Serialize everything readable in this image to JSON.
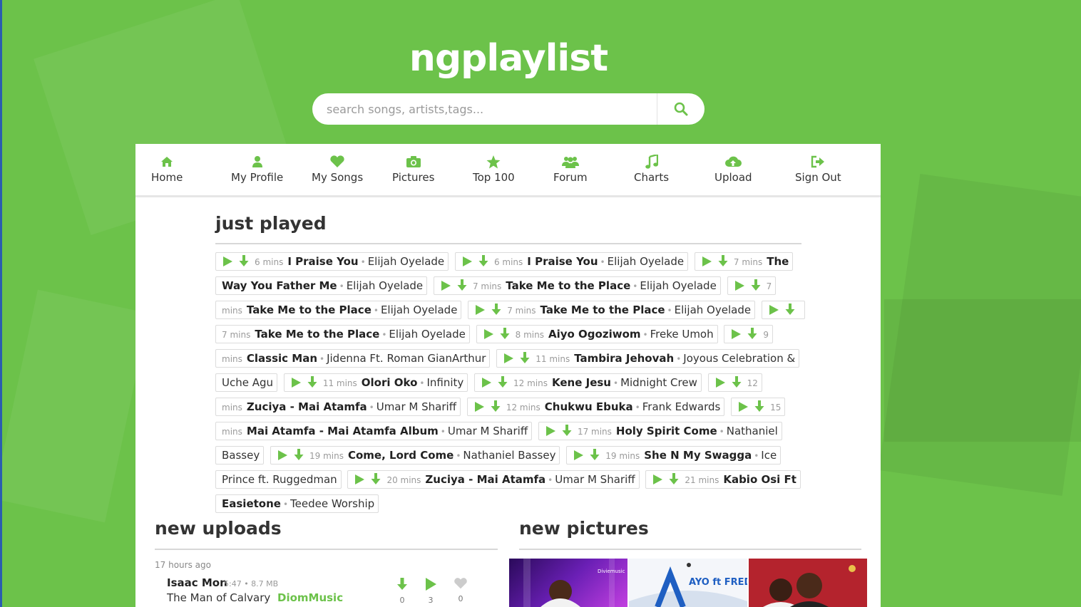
{
  "site": {
    "logo": "ngplaylist"
  },
  "search": {
    "placeholder": "search songs, artists,tags...",
    "value": ""
  },
  "nav": [
    {
      "label": "Home",
      "icon": "home-icon"
    },
    {
      "label": "My Profile",
      "icon": "user-icon"
    },
    {
      "label": "My Songs",
      "icon": "heart-icon"
    },
    {
      "label": "Pictures",
      "icon": "camera-icon"
    },
    {
      "label": "Top 100",
      "icon": "star-icon"
    },
    {
      "label": "Forum",
      "icon": "users-icon"
    },
    {
      "label": "Charts",
      "icon": "music-icon"
    },
    {
      "label": "Upload",
      "icon": "cloud-upload-icon"
    },
    {
      "label": "Sign Out",
      "icon": "sign-out-icon"
    }
  ],
  "just_played": {
    "heading": "just played",
    "songs": [
      {
        "mins": "6 mins",
        "title": "I Praise You",
        "artist": "Elijah Oyelade"
      },
      {
        "mins": "6 mins",
        "title": "I Praise You",
        "artist": "Elijah Oyelade"
      },
      {
        "mins": "7 mins",
        "title": "The Way You Father Me",
        "artist": "Elijah Oyelade"
      },
      {
        "mins": "7 mins",
        "title": "Take Me to the Place",
        "artist": "Elijah Oyelade"
      },
      {
        "mins": "7 mins",
        "title": "Take Me to the Place",
        "artist": "Elijah Oyelade"
      },
      {
        "mins": "7 mins",
        "title": "Take Me to the Place",
        "artist": "Elijah Oyelade"
      },
      {
        "mins": "7 mins",
        "title": "Take Me to the Place",
        "artist": "Elijah Oyelade"
      },
      {
        "mins": "8 mins",
        "title": "Aiyo Ogoziwom",
        "artist": "Freke Umoh"
      },
      {
        "mins": "9 mins",
        "title": "Classic Man",
        "artist": "Jidenna Ft. Roman GianArthur"
      },
      {
        "mins": "11 mins",
        "title": "Tambira Jehovah",
        "artist": "Joyous Celebration & Uche Agu"
      },
      {
        "mins": "11 mins",
        "title": "Olori Oko",
        "artist": "Infinity"
      },
      {
        "mins": "12 mins",
        "title": "Kene Jesu",
        "artist": "Midnight Crew"
      },
      {
        "mins": "12 mins",
        "title": "Zuciya - Mai Atamfa",
        "artist": "Umar M Shariff"
      },
      {
        "mins": "12 mins",
        "title": "Chukwu Ebuka",
        "artist": "Frank Edwards"
      },
      {
        "mins": "15 mins",
        "title": "Mai Atamfa - Mai Atamfa Album",
        "artist": "Umar M Shariff"
      },
      {
        "mins": "17 mins",
        "title": "Holy Spirit Come",
        "artist": "Nathaniel Bassey"
      },
      {
        "mins": "19 mins",
        "title": "Come, Lord Come",
        "artist": "Nathaniel Bassey"
      },
      {
        "mins": "19 mins",
        "title": "She N My Swagga",
        "artist": "Ice Prince ft. Ruggedman"
      },
      {
        "mins": "20 mins",
        "title": "Zuciya - Mai Atamfa",
        "artist": "Umar M Shariff"
      },
      {
        "mins": "21 mins",
        "title": "Kabio Osi Ft Easietone",
        "artist": "Teedee Worship"
      }
    ]
  },
  "new_uploads": {
    "heading": "new uploads",
    "items": [
      {
        "ago": "17 hours ago",
        "artist": "Isaac Mon",
        "meta": "5:47 • 8.7 MB",
        "title": "The Man of Calvary",
        "tag": "DiomMusic",
        "downloads": "0",
        "plays": "3",
        "likes": "0"
      }
    ]
  },
  "new_pictures": {
    "heading": "new pictures",
    "thumbs": [
      {
        "caption": "Diviemusic"
      },
      {
        "caption": "AYO ft FRED"
      },
      {
        "caption": ""
      }
    ]
  },
  "colors": {
    "brand": "#6cc24a",
    "panel": "#ffffff",
    "text": "#333333"
  }
}
